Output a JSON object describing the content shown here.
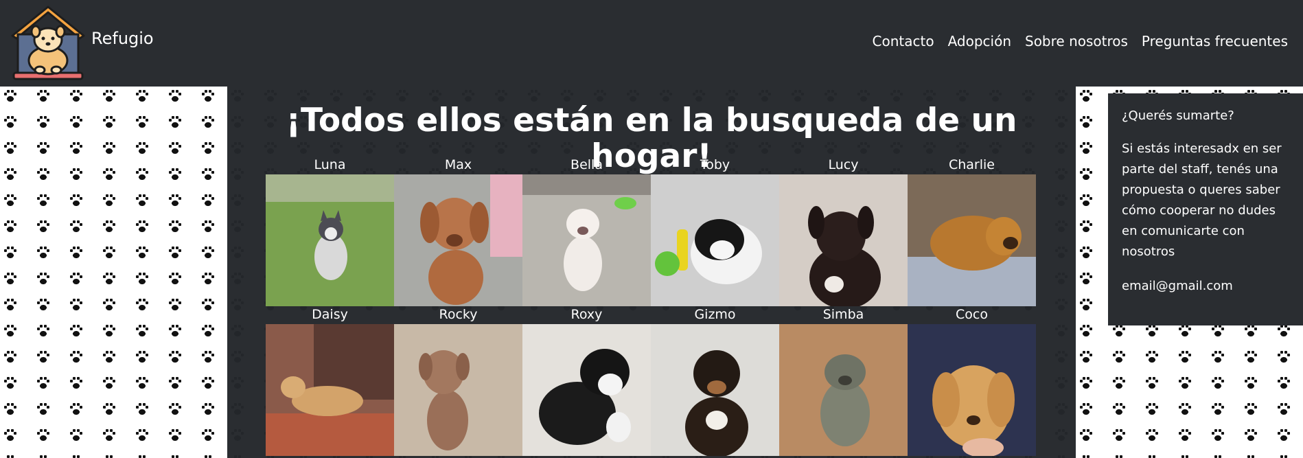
{
  "brand": {
    "name": "Refugio"
  },
  "nav": {
    "items": [
      {
        "label": "Contacto"
      },
      {
        "label": "Adopción"
      },
      {
        "label": "Sobre nosotros"
      },
      {
        "label": "Preguntas frecuentes"
      }
    ]
  },
  "main": {
    "headline": "¡Todos ellos están en la busqueda de un hogar!",
    "dogs": [
      {
        "name": "Luna"
      },
      {
        "name": "Max"
      },
      {
        "name": "Bella"
      },
      {
        "name": "Toby"
      },
      {
        "name": "Lucy"
      },
      {
        "name": "Charlie"
      },
      {
        "name": "Daisy"
      },
      {
        "name": "Rocky"
      },
      {
        "name": "Roxy"
      },
      {
        "name": "Gizmo"
      },
      {
        "name": "Simba"
      },
      {
        "name": "Coco"
      }
    ]
  },
  "sidebar": {
    "title": "¿Querés sumarte?",
    "body": "Si estás interesadx en ser parte del staff, tenés una propuesta o queres saber cómo cooperar no dudes en comunicarte con nosotros",
    "email": "email@gmail.com"
  },
  "colors": {
    "background_dark": "#2a2d31",
    "text_light": "#ffffff",
    "logo_roof": "#f4a340",
    "logo_house": "#5c6f92"
  },
  "icons": {
    "logo": "dog-house-logo",
    "background_pattern": "paw-print-pattern"
  }
}
